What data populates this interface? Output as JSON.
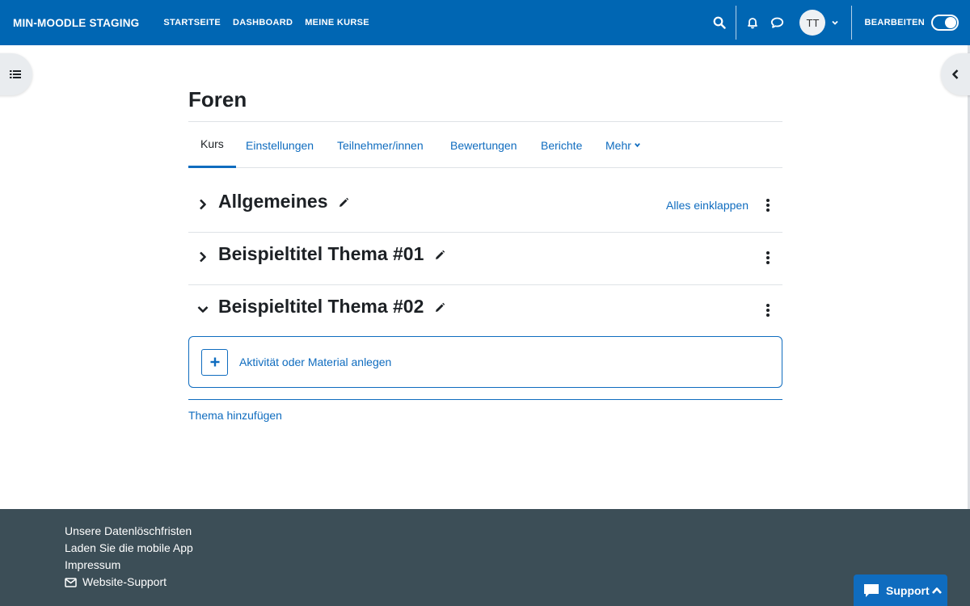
{
  "navbar": {
    "brand": "MIN-MOODLE STAGING",
    "links": [
      "STARTSEITE",
      "DASHBOARD",
      "MEINE KURSE"
    ],
    "avatar_initials": "TT",
    "edit_label": "BEARBEITEN",
    "edit_mode_on": true,
    "color": "#0066b3"
  },
  "page": {
    "title": "Foren"
  },
  "tabs": [
    "Kurs",
    "Einstellungen",
    "Teilnehmer/innen",
    "Bewertungen",
    "Berichte",
    "Mehr"
  ],
  "sections": [
    {
      "title": "Allgemeines",
      "expanded": false
    },
    {
      "title": "Beispieltitel Thema #01",
      "expanded": false
    },
    {
      "title": "Beispieltitel Thema #02",
      "expanded": true
    }
  ],
  "collapse_all_label": "Alles einklappen",
  "add_activity_label": "Aktivität oder Material anlegen",
  "add_topic_label": "Thema hinzufügen",
  "footer": {
    "links": [
      "Unsere Datenlöschfristen",
      "Laden Sie die mobile App",
      "Impressum",
      "Website-Support"
    ],
    "color": "#3c4e57"
  },
  "support_button_label": "Support",
  "accent_color": "#0f6cbf",
  "icons": [
    "search-icon",
    "bell-icon",
    "chat-icon",
    "chevron-down-icon",
    "list-icon",
    "chevron-left-icon",
    "chevron-right-icon",
    "pencil-icon",
    "kebab-icon",
    "plus-icon",
    "envelope-icon",
    "chat-bubble-icon",
    "chevron-up-icon"
  ]
}
